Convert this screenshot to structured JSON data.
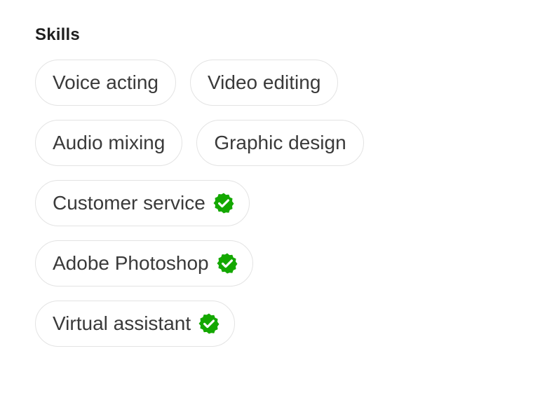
{
  "skills": {
    "title": "Skills",
    "rows": [
      [
        {
          "label": "Voice acting",
          "verified": false
        },
        {
          "label": "Video editing",
          "verified": false
        }
      ],
      [
        {
          "label": "Audio mixing",
          "verified": false
        },
        {
          "label": "Graphic design",
          "verified": false
        }
      ],
      [
        {
          "label": "Customer service",
          "verified": true
        }
      ],
      [
        {
          "label": "Adobe Photoshop",
          "verified": true
        }
      ],
      [
        {
          "label": "Virtual assistant",
          "verified": true
        }
      ]
    ],
    "verified_icon": "verified-badge-icon",
    "verified_color": "#14a800"
  }
}
